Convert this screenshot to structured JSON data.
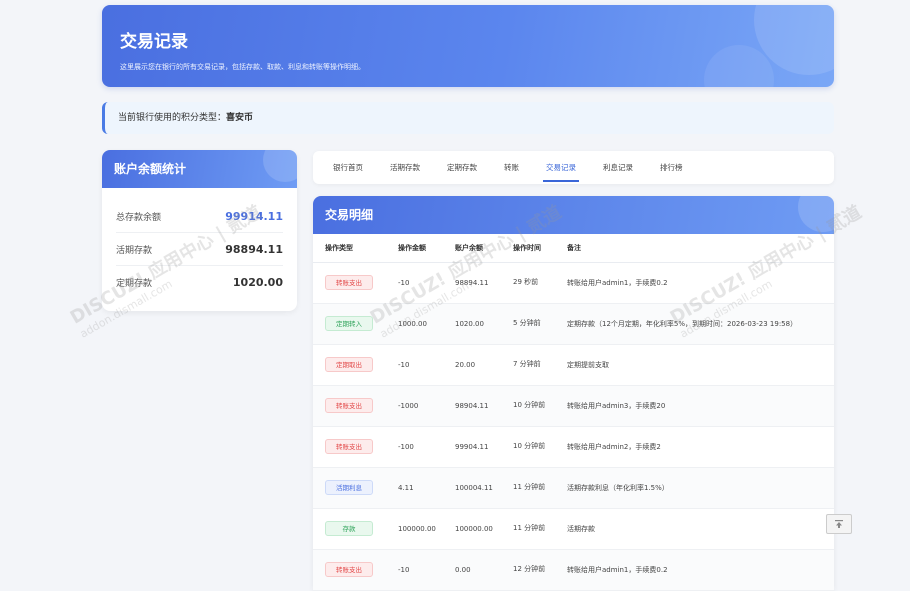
{
  "header": {
    "title": "交易记录",
    "subtitle": "这里展示您在银行的所有交易记录，包括存款、取款、利息和转账等操作明细。"
  },
  "notice": {
    "label": "当前银行使用的积分类型：",
    "currency": "喜安币"
  },
  "summary": {
    "title": "账户余额统计",
    "rows": [
      {
        "label": "总存款余额",
        "value": "99914.11"
      },
      {
        "label": "活期存款",
        "value": "98894.11"
      },
      {
        "label": "定期存款",
        "value": "1020.00"
      }
    ]
  },
  "tabs": [
    "银行首页",
    "活期存款",
    "定期存款",
    "转账",
    "交易记录",
    "利息记录",
    "排行榜"
  ],
  "active_tab": "交易记录",
  "table": {
    "title": "交易明细",
    "columns": [
      "操作类型",
      "操作金额",
      "账户余额",
      "操作时间",
      "备注"
    ],
    "rows": [
      {
        "type": "转账支出",
        "amount": "-10",
        "balance": "98894.11",
        "time": "29 秒前",
        "note": "转账给用户admin1，手续费0.2"
      },
      {
        "type": "定期转入",
        "amount": "1000.00",
        "balance": "1020.00",
        "time": "5 分钟前",
        "note": "定期存款（12个月定期，年化利率5%，到期时间：2026-03-23 19:58）"
      },
      {
        "type": "定期取出",
        "amount": "-10",
        "balance": "20.00",
        "time": "7 分钟前",
        "note": "定期提前支取"
      },
      {
        "type": "转账支出",
        "amount": "-1000",
        "balance": "98904.11",
        "time": "10 分钟前",
        "note": "转账给用户admin3，手续费20"
      },
      {
        "type": "转账支出",
        "amount": "-100",
        "balance": "99904.11",
        "time": "10 分钟前",
        "note": "转账给用户admin2，手续费2"
      },
      {
        "type": "活期利息",
        "amount": "4.11",
        "balance": "100004.11",
        "time": "11 分钟前",
        "note": "活期存款利息（年化利率1.5%）"
      },
      {
        "type": "存款",
        "amount": "100000.00",
        "balance": "100000.00",
        "time": "11 分钟前",
        "note": "活期存款"
      },
      {
        "type": "转账支出",
        "amount": "-10",
        "balance": "0.00",
        "time": "12 分钟前",
        "note": "转账给用户admin1，手续费0.2"
      }
    ]
  },
  "watermark": {
    "brand": "DISCUZ! 应用中心 | 贰道",
    "url": "addon.dismall.com"
  },
  "colors": {
    "primary": "#4a6fe0",
    "expense_red": "#e24848",
    "income_green": "#2fa35a",
    "interest_blue": "#4a6fe0"
  }
}
